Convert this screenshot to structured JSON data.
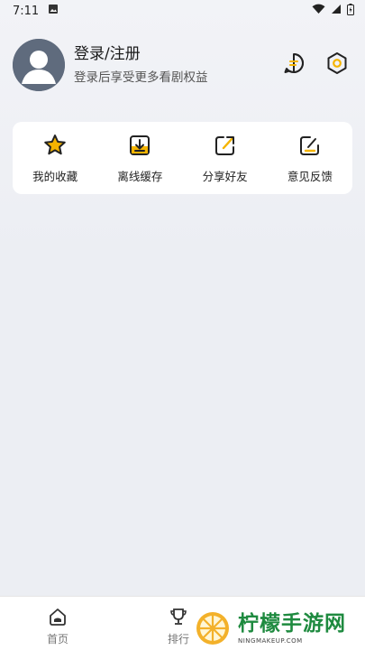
{
  "status_bar": {
    "time": "7:11",
    "icons": [
      "image-icon",
      "wifi-icon",
      "signal-icon",
      "battery-charging-icon"
    ]
  },
  "profile": {
    "title": "登录/注册",
    "subtitle": "登录后享受更多看剧权益",
    "actions": [
      "message-icon",
      "settings-icon"
    ]
  },
  "quick_actions": [
    {
      "label": "我的收藏",
      "icon": "star-icon"
    },
    {
      "label": "离线缓存",
      "icon": "download-icon"
    },
    {
      "label": "分享好友",
      "icon": "share-icon"
    },
    {
      "label": "意见反馈",
      "icon": "feedback-icon"
    }
  ],
  "bottom_nav": {
    "home_label": "首页",
    "rank_label": "排行"
  },
  "watermark": {
    "main": "柠檬手游网",
    "sub": "NINGMAKEUP.COM"
  },
  "colors": {
    "accent": "#f5b400",
    "background": "#eceef3",
    "card": "#ffffff",
    "icon_stroke": "#222222"
  }
}
